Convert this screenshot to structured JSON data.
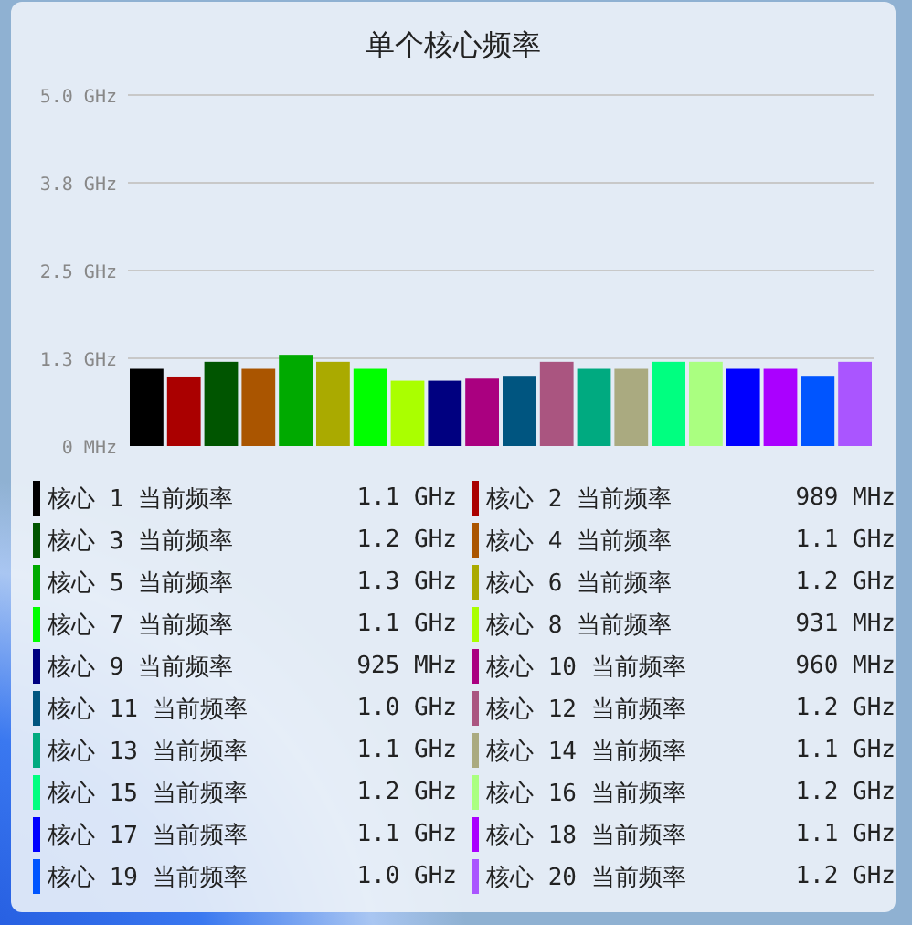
{
  "card": {
    "title": "单个核心频率",
    "chart_data": {
      "type": "bar",
      "grid": true,
      "ylim": [
        0,
        5
      ],
      "yticks": [
        {
          "value": 0,
          "label": "0 MHz"
        },
        {
          "value": 1.25,
          "label": "1.3 GHz"
        },
        {
          "value": 2.5,
          "label": "2.5 GHz"
        },
        {
          "value": 3.75,
          "label": "3.8 GHz"
        },
        {
          "value": 5,
          "label": "5.0 GHz"
        }
      ],
      "values": [
        1.1,
        0.99,
        1.2,
        1.1,
        1.3,
        1.2,
        1.1,
        0.93,
        0.93,
        0.96,
        1.0,
        1.2,
        1.1,
        1.1,
        1.2,
        1.2,
        1.1,
        1.1,
        1.0,
        1.2
      ]
    },
    "legend": [
      {
        "label": "核心 1 当前频率",
        "value": "1.1 GHz",
        "color": "#000000"
      },
      {
        "label": "核心 2 当前频率",
        "value": "989 MHz",
        "color": "#aa0000"
      },
      {
        "label": "核心 3 当前频率",
        "value": "1.2 GHz",
        "color": "#005500"
      },
      {
        "label": "核心 4 当前频率",
        "value": "1.1 GHz",
        "color": "#aa5500"
      },
      {
        "label": "核心 5 当前频率",
        "value": "1.3 GHz",
        "color": "#00aa00"
      },
      {
        "label": "核心 6 当前频率",
        "value": "1.2 GHz",
        "color": "#aaaa00"
      },
      {
        "label": "核心 7 当前频率",
        "value": "1.1 GHz",
        "color": "#00ff00"
      },
      {
        "label": "核心 8 当前频率",
        "value": "931 MHz",
        "color": "#aaff00"
      },
      {
        "label": "核心 9 当前频率",
        "value": "925 MHz",
        "color": "#000080"
      },
      {
        "label": "核心 10 当前频率",
        "value": "960 MHz",
        "color": "#aa0080"
      },
      {
        "label": "核心 11 当前频率",
        "value": "1.0 GHz",
        "color": "#005580"
      },
      {
        "label": "核心 12 当前频率",
        "value": "1.2 GHz",
        "color": "#aa5580"
      },
      {
        "label": "核心 13 当前频率",
        "value": "1.1 GHz",
        "color": "#00aa80"
      },
      {
        "label": "核心 14 当前频率",
        "value": "1.1 GHz",
        "color": "#aaaa80"
      },
      {
        "label": "核心 15 当前频率",
        "value": "1.2 GHz",
        "color": "#00ff80"
      },
      {
        "label": "核心 16 当前频率",
        "value": "1.2 GHz",
        "color": "#aaff80"
      },
      {
        "label": "核心 17 当前频率",
        "value": "1.1 GHz",
        "color": "#0000ff"
      },
      {
        "label": "核心 18 当前频率",
        "value": "1.1 GHz",
        "color": "#aa00ff"
      },
      {
        "label": "核心 19 当前频率",
        "value": "1.0 GHz",
        "color": "#0055ff"
      },
      {
        "label": "核心 20 当前频率",
        "value": "1.2 GHz",
        "color": "#aa55ff"
      }
    ]
  }
}
